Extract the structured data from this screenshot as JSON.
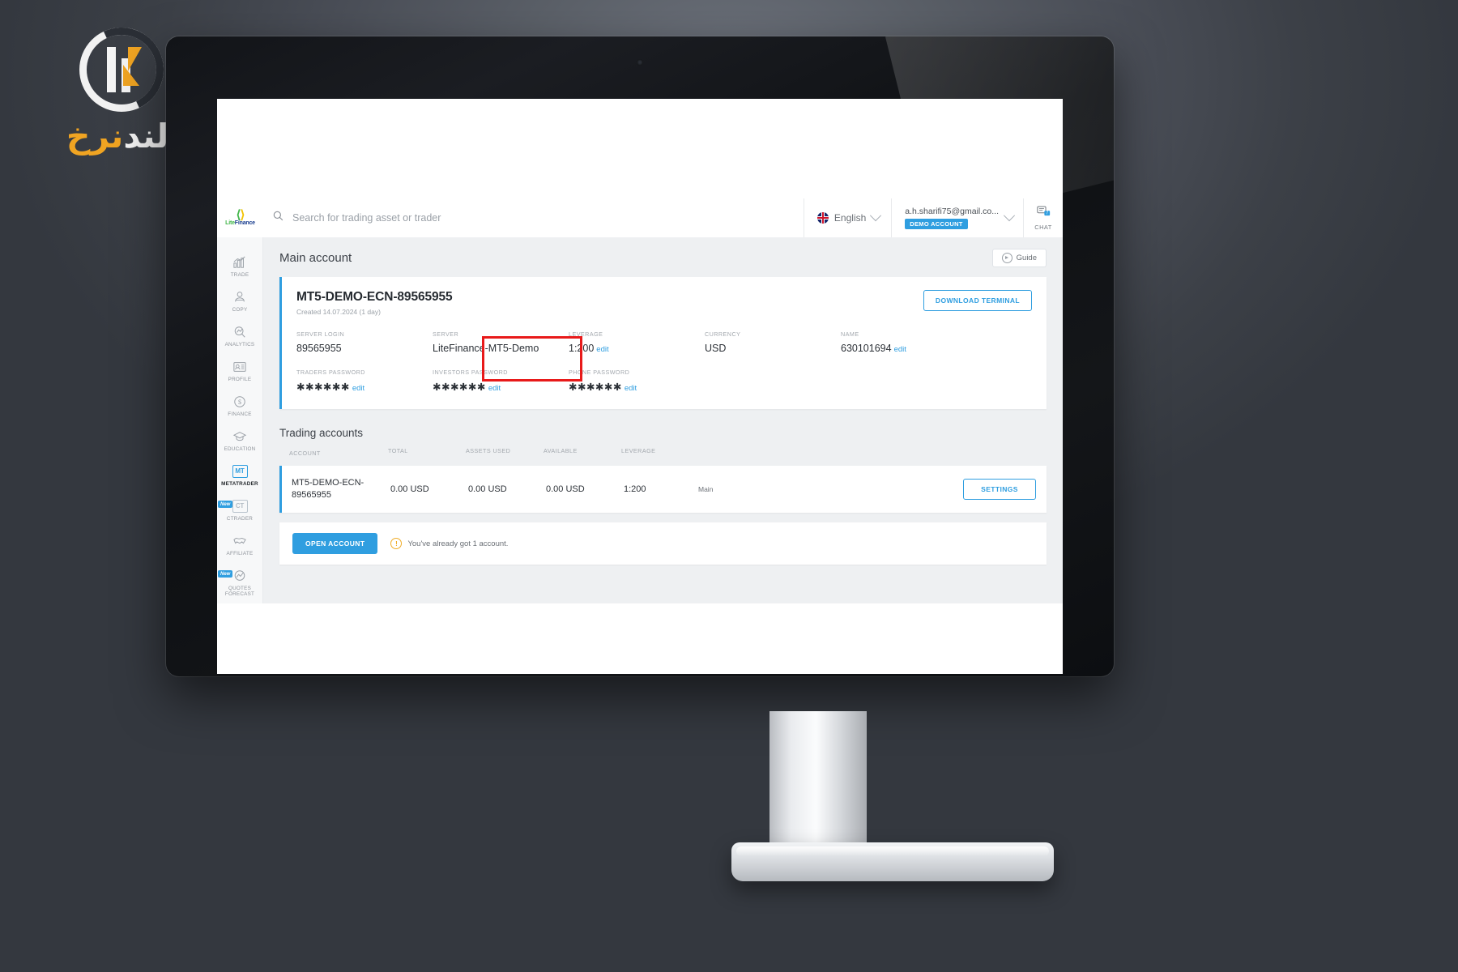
{
  "brand": {
    "name_a": "Lite",
    "name_b": "Finance"
  },
  "watermark": {
    "text_fa": "نرخ",
    "text_fa_accent": "لند"
  },
  "header": {
    "search_placeholder": "Search for trading asset or trader",
    "search_value": "",
    "search_icon": "search-icon",
    "language": "English",
    "language_flag": "uk-flag-icon",
    "email": "a.h.sharifi75@gmail.co...",
    "account_badge": "DEMO ACCOUNT",
    "chat_label": "CHAT",
    "chat_count": "7"
  },
  "sidebar": {
    "items": [
      {
        "label": "TRADE",
        "icon": "chart-bars-icon",
        "active": false,
        "badge": ""
      },
      {
        "label": "COPY",
        "icon": "person-copy-icon",
        "active": false,
        "badge": ""
      },
      {
        "label": "ANALYTICS",
        "icon": "magnifier-chart-icon",
        "active": false,
        "badge": ""
      },
      {
        "label": "PROFILE",
        "icon": "id-card-icon",
        "active": false,
        "badge": ""
      },
      {
        "label": "FINANCE",
        "icon": "dollar-circle-icon",
        "active": false,
        "badge": ""
      },
      {
        "label": "EDUCATION",
        "icon": "graduation-cap-icon",
        "active": false,
        "badge": ""
      },
      {
        "label": "METATRADER",
        "icon": "mt-box-icon",
        "active": true,
        "badge": "",
        "box_text": "MT"
      },
      {
        "label": "CTRADER",
        "icon": "ct-box-icon",
        "active": false,
        "badge": "New",
        "box_text": "CT"
      },
      {
        "label": "AFFILIATE",
        "icon": "handshake-icon",
        "active": false,
        "badge": ""
      },
      {
        "label": "QUOTES FORECAST",
        "icon": "forecast-icon",
        "active": false,
        "badge": "New"
      }
    ]
  },
  "main": {
    "page_title": "Main account",
    "guide_button": "Guide",
    "account_card": {
      "title": "MT5-DEMO-ECN-89565955",
      "created": "Created 14.07.2024 (1 day)",
      "download_button": "DOWNLOAD TERMINAL",
      "fields_row1": [
        {
          "label": "SERVER LOGIN",
          "value": "89565955",
          "edit": ""
        },
        {
          "label": "SERVER",
          "value": "LiteFinance-MT5-Demo",
          "edit": ""
        },
        {
          "label": "LEVERAGE",
          "value": "1:200",
          "edit": "edit",
          "highlighted": true
        },
        {
          "label": "CURRENCY",
          "value": "USD",
          "edit": ""
        },
        {
          "label": "NAME",
          "value": "630101694",
          "edit": "edit"
        }
      ],
      "fields_row2": [
        {
          "label": "TRADERS PASSWORD",
          "value": "✱✱✱✱✱✱",
          "edit": "edit"
        },
        {
          "label": "INVESTORS PASSWORD",
          "value": "✱✱✱✱✱✱",
          "edit": "edit"
        },
        {
          "label": "PHONE PASSWORD",
          "value": "✱✱✱✱✱✱",
          "edit": "edit"
        }
      ]
    },
    "trading_accounts": {
      "section_title": "Trading accounts",
      "columns": [
        "ACCOUNT",
        "TOTAL",
        "ASSETS USED",
        "AVAILABLE",
        "LEVERAGE"
      ],
      "rows": [
        {
          "account": "MT5-DEMO-ECN-89565955",
          "total": "0.00 USD",
          "assets_used": "0.00 USD",
          "available": "0.00 USD",
          "leverage": "1:200",
          "type": "Main",
          "settings_button": "SETTINGS"
        }
      ]
    },
    "footer": {
      "open_account_button": "OPEN ACCOUNT",
      "notice": "You've already got 1 account.",
      "notice_icon": "warning-icon"
    }
  },
  "colors": {
    "accent_blue": "#2f9ee0",
    "highlight_red": "#e81a1a",
    "brand_green": "#41b649",
    "warning_yellow": "#f0ad28"
  }
}
